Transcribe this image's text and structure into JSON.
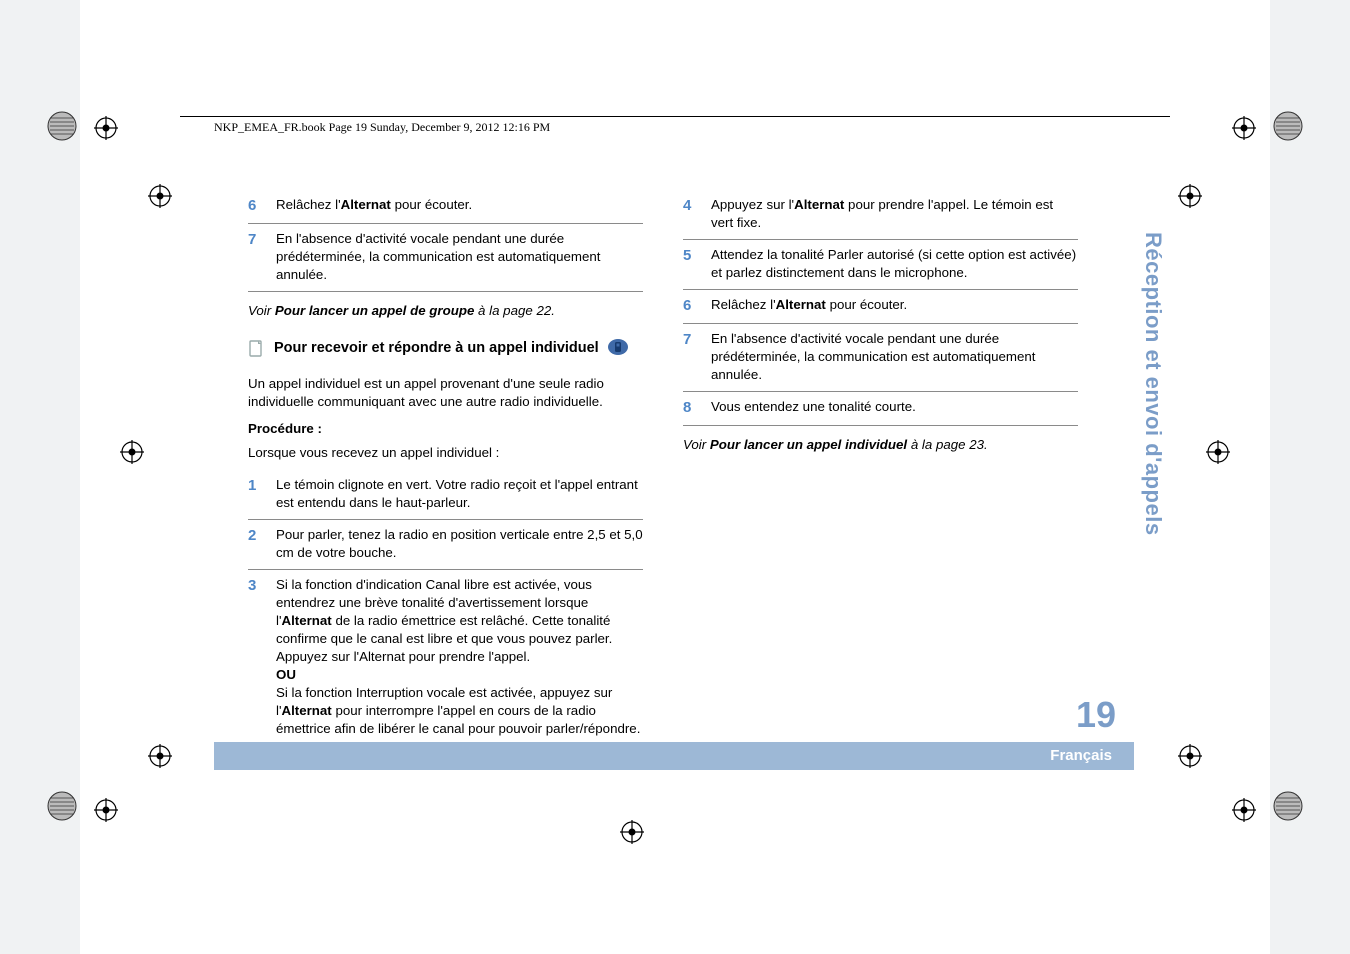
{
  "header": "NKP_EMEA_FR.book  Page 19  Sunday, December 9, 2012  12:16 PM",
  "sideTitle": "Réception et envoi d'appels",
  "pageNumber": "19",
  "language": "Français",
  "left": {
    "steps_top": [
      {
        "n": "6",
        "pre": "Relâchez l'",
        "bold": "Alternat",
        "post": " pour écouter."
      },
      {
        "n": "7",
        "text": "En l'absence d'activité vocale pendant une durée prédéterminée, la communication est automatiquement annulée."
      }
    ],
    "ref1_pre": "Voir ",
    "ref1_bold": "Pour lancer un appel de groupe",
    "ref1_post": " à la page 22.",
    "section": "Pour recevoir et répondre à un appel individuel",
    "intro": "Un appel individuel est un appel provenant d'une seule radio individuelle communiquant avec une autre radio individuelle.",
    "proc": "Procédure :",
    "when": "Lorsque vous recevez un appel individuel :",
    "steps_bottom": [
      {
        "n": "1",
        "text": "Le témoin clignote en vert. Votre radio reçoit et l'appel entrant est entendu dans le haut-parleur."
      },
      {
        "n": "2",
        "text": "Pour parler, tenez la radio en position verticale entre 2,5 et 5,0 cm de votre bouche."
      },
      {
        "n": "3",
        "l1a": "Si la fonction d'indication Canal libre est activée, vous entendrez une brève tonalité d'avertissement lorsque l'",
        "l1b": "Alternat",
        "l1c": " de la radio émettrice est relâché. Cette tonalité confirme que le canal est libre et que vous pouvez parler.",
        "l2": "Appuyez sur l'Alternat pour prendre l'appel.",
        "ou": "OU",
        "l3a": "Si la fonction Interruption vocale est activée, appuyez sur l'",
        "l3b": "Alternat",
        "l3c": " pour interrompre l'appel en cours de la radio émettrice afin de libérer le canal pour pouvoir parler/répondre."
      }
    ]
  },
  "right": {
    "steps": [
      {
        "n": "4",
        "pre": "Appuyez sur l'",
        "bold": "Alternat",
        "post": " pour prendre l'appel. Le témoin est vert fixe."
      },
      {
        "n": "5",
        "text": "Attendez la tonalité Parler autorisé (si cette option est activée) et parlez distinctement dans le microphone."
      },
      {
        "n": "6",
        "pre": "Relâchez l'",
        "bold": "Alternat",
        "post": " pour écouter."
      },
      {
        "n": "7",
        "text": "En l'absence d'activité vocale pendant une durée prédéterminée, la communication est automatiquement annulée."
      },
      {
        "n": "8",
        "text": "Vous entendez une tonalité courte."
      }
    ],
    "ref_pre": "Voir ",
    "ref_bold": "Pour lancer un appel individuel",
    "ref_post": " à la page 23."
  }
}
